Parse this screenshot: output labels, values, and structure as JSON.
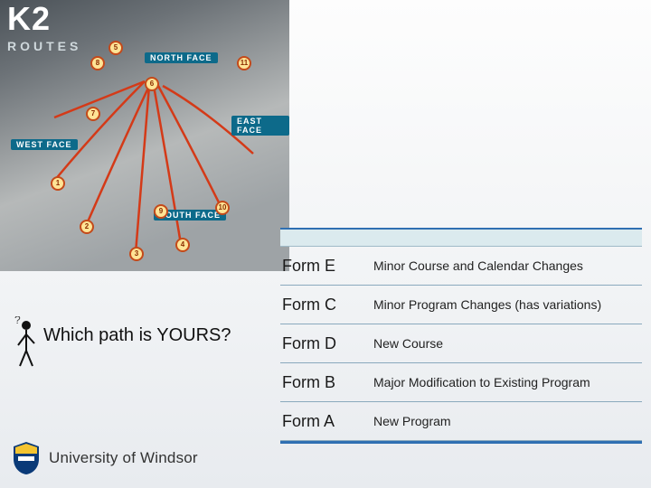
{
  "logo": {
    "line1": "K2",
    "line2": "ROUTES"
  },
  "map_labels": {
    "north": "NORTH FACE",
    "west": "WEST FACE",
    "east": "EAST FACE",
    "south": "SOUTH FACE"
  },
  "route_markers": [
    "1",
    "2",
    "3",
    "4",
    "5",
    "6",
    "7",
    "8",
    "9",
    "10",
    "11"
  ],
  "question": "Which path is YOURS?",
  "forms": [
    {
      "code": "Form E",
      "desc": "Minor Course and Calendar Changes"
    },
    {
      "code": "Form C",
      "desc": "Minor Program Changes (has variations)"
    },
    {
      "code": "Form D",
      "desc": "New Course"
    },
    {
      "code": "Form B",
      "desc": "Major Modification to Existing Program"
    },
    {
      "code": "Form A",
      "desc": "New Program"
    }
  ],
  "footer": {
    "university": "University of Windsor"
  }
}
